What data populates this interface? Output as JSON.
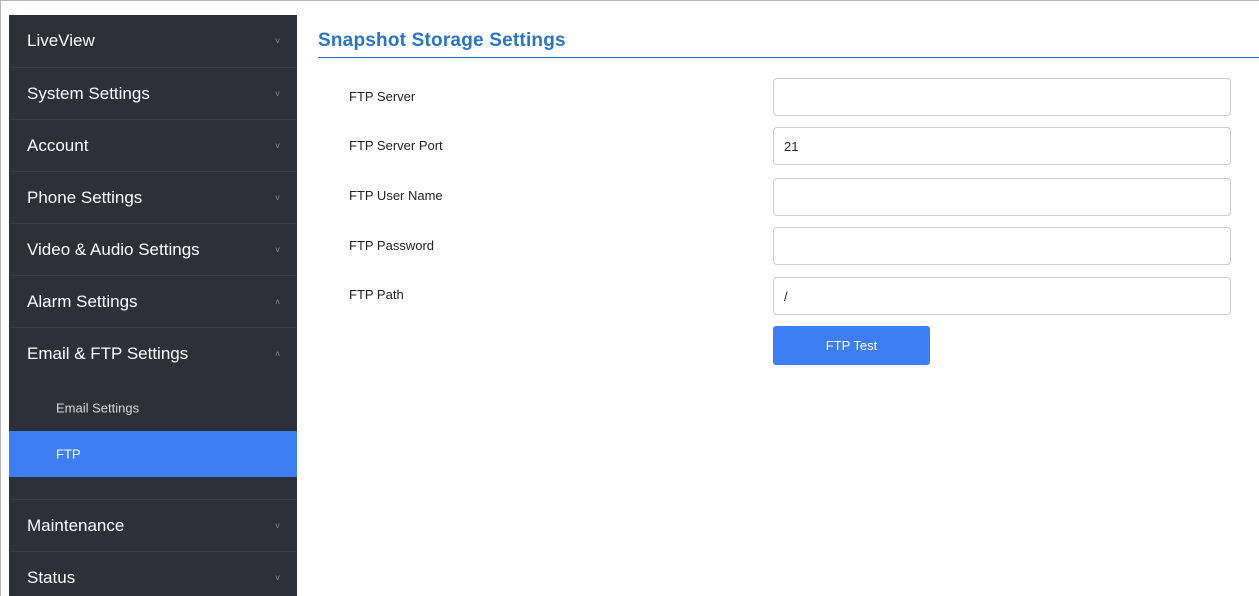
{
  "sidebar": {
    "items": [
      {
        "label": "LiveView",
        "chevron": "˅"
      },
      {
        "label": "System Settings",
        "chevron": "˅"
      },
      {
        "label": "Account",
        "chevron": "˅"
      },
      {
        "label": "Phone Settings",
        "chevron": "˅"
      },
      {
        "label": "Video & Audio Settings",
        "chevron": "˅"
      },
      {
        "label": "Alarm Settings",
        "chevron": "˄"
      },
      {
        "label": "Email & FTP Settings",
        "chevron": "˄"
      }
    ],
    "subitems": [
      {
        "label": "Email Settings",
        "active": false
      },
      {
        "label": "FTP",
        "active": true
      }
    ],
    "items_after": [
      {
        "label": "Maintenance",
        "chevron": "˅"
      },
      {
        "label": "Status",
        "chevron": "˅"
      }
    ]
  },
  "main": {
    "title": "Snapshot Storage Settings",
    "fields": [
      {
        "label": "FTP Server",
        "value": ""
      },
      {
        "label": "FTP Server Port",
        "value": "21"
      },
      {
        "label": "FTP User Name",
        "value": ""
      },
      {
        "label": "FTP Password",
        "value": ""
      },
      {
        "label": "FTP Path",
        "value": "/"
      }
    ],
    "test_button_label": "FTP Test"
  },
  "colors": {
    "sidebar_bg": "#2e3039",
    "accent": "#3d7ef5",
    "title": "#2a74c5"
  }
}
